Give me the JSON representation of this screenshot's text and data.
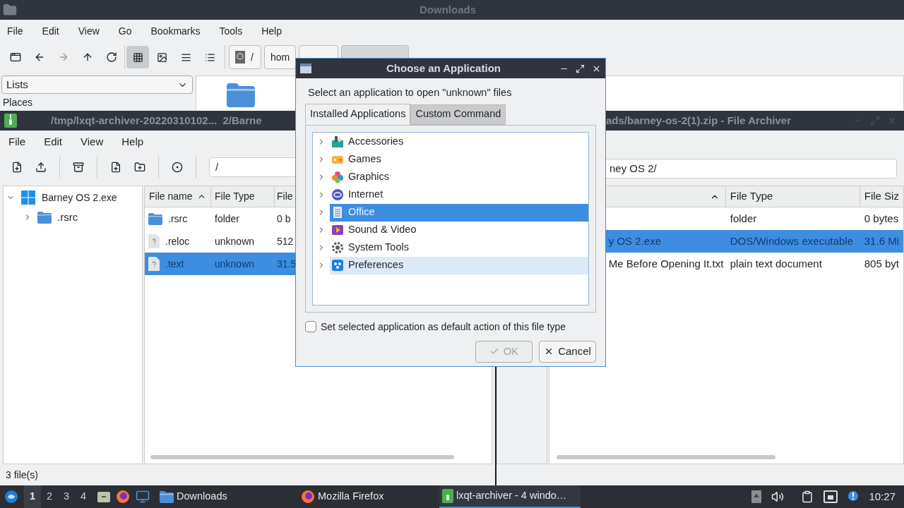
{
  "downloads_window": {
    "title": "Downloads",
    "menu": [
      "File",
      "Edit",
      "View",
      "Go",
      "Bookmarks",
      "Tools",
      "Help"
    ],
    "view_modes": [
      {
        "kind": "icons",
        "selected": true
      },
      {
        "kind": "thumbnails",
        "selected": false
      },
      {
        "kind": "compact",
        "selected": false
      },
      {
        "kind": "details",
        "selected": false
      }
    ],
    "path_buttons": [
      "/",
      "hom"
    ],
    "side_pane_mode": "Lists",
    "side_pane_heading": "Places"
  },
  "archiver_left": {
    "title": "/tmp/lxqt-archiver-20220310102...  2/Barne",
    "menu": [
      "File",
      "Edit",
      "View",
      "Help"
    ],
    "path": "/",
    "tree": [
      {
        "label": "Barney OS 2.exe",
        "kind": "exe",
        "expanded": true,
        "children": [
          {
            "label": ".rsrc",
            "kind": "folder",
            "expanded": false
          }
        ]
      }
    ],
    "columns": [
      "File name",
      "File Type",
      "File"
    ],
    "rows": [
      {
        "name": ".rsrc",
        "kind": "folder",
        "type": "folder",
        "size": "0 b",
        "selected": false
      },
      {
        "name": ".reloc",
        "kind": "unknown",
        "type": "unknown",
        "size": "512",
        "selected": false
      },
      {
        "name": ".text",
        "kind": "unknown",
        "type": "unknown",
        "size": "31.5",
        "selected": true
      }
    ],
    "status": "3 file(s)"
  },
  "archiver_right": {
    "title": "ads/barney-os-2(1).zip - File Archiver",
    "path": "ney OS 2/",
    "columns": [
      "File Type",
      "File Siz"
    ],
    "rows": [
      {
        "type": "folder",
        "size": "0 bytes",
        "selected": false
      },
      {
        "name": "y OS 2.exe",
        "type": "DOS/Windows executable",
        "size": "31.6 Mi",
        "selected": true
      },
      {
        "name": "Me Before Opening It.txt",
        "type": "plain text document",
        "size": "805 byt",
        "selected": false
      }
    ]
  },
  "dialog": {
    "title": "Choose an Application",
    "prompt": "Select an application to open \"unknown\" files",
    "tabs": [
      {
        "label": "Installed Applications",
        "selected": true
      },
      {
        "label": "Custom Command",
        "selected": false
      }
    ],
    "categories": [
      {
        "label": "Accessories",
        "kind": "accessories",
        "selected": false,
        "hovered": false
      },
      {
        "label": "Games",
        "kind": "games",
        "selected": false,
        "hovered": false
      },
      {
        "label": "Graphics",
        "kind": "graphics",
        "selected": false,
        "hovered": false
      },
      {
        "label": "Internet",
        "kind": "internet",
        "selected": false,
        "hovered": false
      },
      {
        "label": "Office",
        "kind": "office",
        "selected": true,
        "hovered": false
      },
      {
        "label": "Sound & Video",
        "kind": "media",
        "selected": false,
        "hovered": false
      },
      {
        "label": "System Tools",
        "kind": "system",
        "selected": false,
        "hovered": false
      },
      {
        "label": "Preferences",
        "kind": "preferences",
        "selected": false,
        "hovered": true
      }
    ],
    "default_option": {
      "label": "Set selected application as default action of this file type",
      "checked": false
    },
    "buttons": [
      {
        "label": "OK",
        "kind": "ok",
        "disabled": true
      },
      {
        "label": "Cancel",
        "kind": "cancel",
        "disabled": false
      }
    ]
  },
  "taskbar": {
    "workspaces": [
      {
        "label": "1",
        "selected": true
      },
      {
        "label": "2",
        "selected": false
      },
      {
        "label": "3",
        "selected": false
      },
      {
        "label": "4",
        "selected": false
      }
    ],
    "tasks": [
      {
        "label": "Downloads",
        "kind": "folder",
        "active": false
      },
      {
        "label": "Mozilla Firefox",
        "kind": "firefox",
        "active": false
      },
      {
        "label": "lxqt-archiver - 4 windo…",
        "kind": "archiver",
        "active": true
      }
    ],
    "clock": "10:27"
  }
}
